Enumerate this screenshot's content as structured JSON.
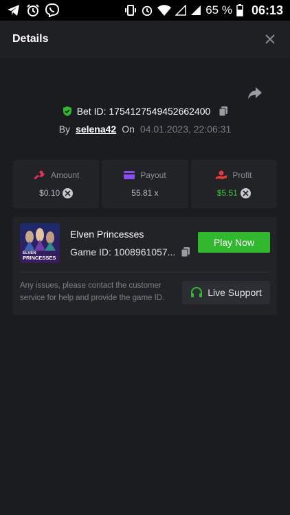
{
  "status_bar": {
    "battery": "65 %",
    "time": "06:13",
    "icons_left": [
      "telegram-icon",
      "alarm-icon",
      "viber-icon"
    ],
    "icons_right": [
      "vibrate-icon",
      "alarm-icon",
      "wifi-icon",
      "signal-icon",
      "signal-icon",
      "battery-icon"
    ]
  },
  "header": {
    "title": "Details",
    "close_icon": "close-icon"
  },
  "bet": {
    "label": "Bet ID: 1754127549452662400",
    "by_label": "By",
    "user": "selena42",
    "on_label": "On",
    "date": "04.01.2023, 22:06:31"
  },
  "stats": [
    {
      "label": "Amount",
      "value": "$0.10",
      "icon": "amount-icon",
      "has_coin": true
    },
    {
      "label": "Payout",
      "value": "55.81 x",
      "icon": "payout-card-icon",
      "has_coin": false
    },
    {
      "label": "Profit",
      "value": "$5.51",
      "icon": "profit-icon",
      "has_coin": true
    }
  ],
  "game": {
    "title": "Elven Princesses",
    "id_label": "Game ID: 1008961057...",
    "play_label": "Play Now",
    "issue_text": "Any issues, please contact the customer service for help and provide the game ID.",
    "support_label": "Live Support",
    "thumb_line1": "ELVEN",
    "thumb_line2": "PRINCESSES"
  },
  "colors": {
    "accent_green": "#32b82e",
    "profit_green": "#35c53a",
    "amount_pink": "#e2335f",
    "payout_purple": "#8b4cf0",
    "profit_red": "#e03a3a"
  }
}
